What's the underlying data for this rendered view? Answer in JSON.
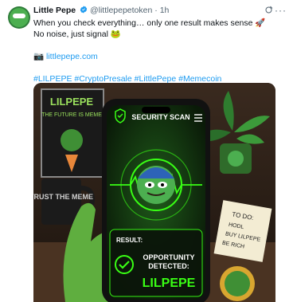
{
  "author": {
    "name": "Little Pepe",
    "handle": "@littlepepetoken",
    "separator": "·",
    "time": "1h"
  },
  "tweet": {
    "line1": "When you check everything… only one result makes sense 🚀",
    "line2": "No noise, just signal 🐸",
    "link_icon": "📷",
    "link": "littlepepe.com",
    "hashtags": "#LILPEPE #CryptoPresale #LittlePepe #Memecoin"
  },
  "image": {
    "poster_title": "LILPEPE",
    "poster_subtitle": "THE FUTURE IS MEME",
    "mug_text": "TRUST THE MEME",
    "phone_header": "SECURITY SCAN",
    "result_label": "RESULT:",
    "result_line1": "OPPORTUNITY",
    "result_line2": "DETECTED:",
    "result_name": "LILPEPE",
    "note_title": "TO DO:",
    "note_items": [
      "HODL",
      "BUY LILPEPE",
      "BE RICH"
    ]
  },
  "colors": {
    "link": "#1d9bf0",
    "verified": "#1d9bf0",
    "screen_green": "#39ff14"
  }
}
